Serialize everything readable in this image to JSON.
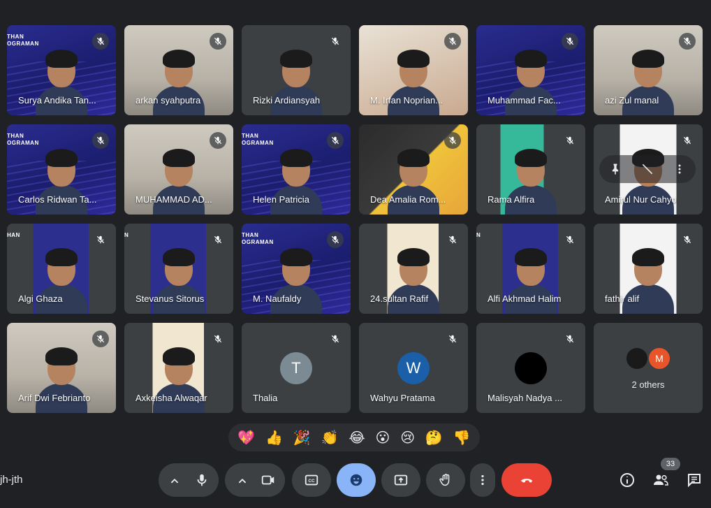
{
  "participants": [
    {
      "name": "Surya Andika Tan...",
      "bg": "blue",
      "brand": "THAN\nOGRAMAN"
    },
    {
      "name": "arkan syahputra",
      "bg": "room"
    },
    {
      "name": "Rizki Ardiansyah",
      "bg": "gray"
    },
    {
      "name": "M. Irfan Noprian...",
      "bg": "warm"
    },
    {
      "name": "Muhammad Fac...",
      "bg": "blue"
    },
    {
      "name": "azi Zul manal",
      "bg": "room"
    },
    {
      "name": "Carlos Ridwan Ta...",
      "bg": "blue",
      "brand": "THAN\nOGRAMAN"
    },
    {
      "name": "MUHAMMAD AD...",
      "bg": "room"
    },
    {
      "name": "Helen Patricia",
      "bg": "blue",
      "brand": "THAN\nOGRAMAN"
    },
    {
      "name": "Dea Amalia Rom...",
      "bg": "yellow"
    },
    {
      "name": "Rama Alfira",
      "bg": "green"
    },
    {
      "name": "Amirul Nur Cahyo",
      "bg": "white",
      "hover": true
    },
    {
      "name": "Algi Ghaza",
      "bg": "pillar",
      "brand": "HAN"
    },
    {
      "name": "Stevanus Sitorus",
      "bg": "pillar",
      "brand": "N"
    },
    {
      "name": "M. Naufaldy",
      "bg": "blue",
      "brand": "THAN\nOGRAMAN"
    },
    {
      "name": "24.sultan Rafif",
      "bg": "cream"
    },
    {
      "name": "Alfi Akhmad Halim",
      "bg": "pillar",
      "brand": "N"
    },
    {
      "name": "fathir alif",
      "bg": "white"
    },
    {
      "name": "Arif Dwi Febrianto",
      "bg": "room"
    },
    {
      "name": "Axkeisha Alwaqar",
      "bg": "cream"
    },
    {
      "name": "Thalia",
      "bg": "gray",
      "avatar": "T",
      "avatar_color": "#7b8a93"
    },
    {
      "name": "Wahyu Pratama",
      "bg": "gray",
      "avatar": "W",
      "avatar_color": "#1a5fa8"
    },
    {
      "name": "Malisyah Nadya ...",
      "bg": "gray",
      "avatar": "",
      "avatar_color": "#000000"
    }
  ],
  "others_tile": {
    "label": "2 others",
    "avatar_letter": "M"
  },
  "reactions": [
    "💖",
    "👍",
    "🎉",
    "👏",
    "😂",
    "😮",
    "😢",
    "🤔",
    "👎"
  ],
  "meeting_code": "jh-jth",
  "participant_count": "33",
  "colors": {
    "background": "#202124",
    "tile": "#3c4043",
    "end_call": "#ea4335",
    "reactions_active": "#8ab4f8"
  },
  "controls": [
    "mic-options",
    "microphone",
    "camera-options",
    "camera",
    "captions",
    "reactions",
    "present",
    "raise-hand",
    "more-options",
    "end-call"
  ],
  "right_controls": [
    "info",
    "people",
    "chat"
  ]
}
